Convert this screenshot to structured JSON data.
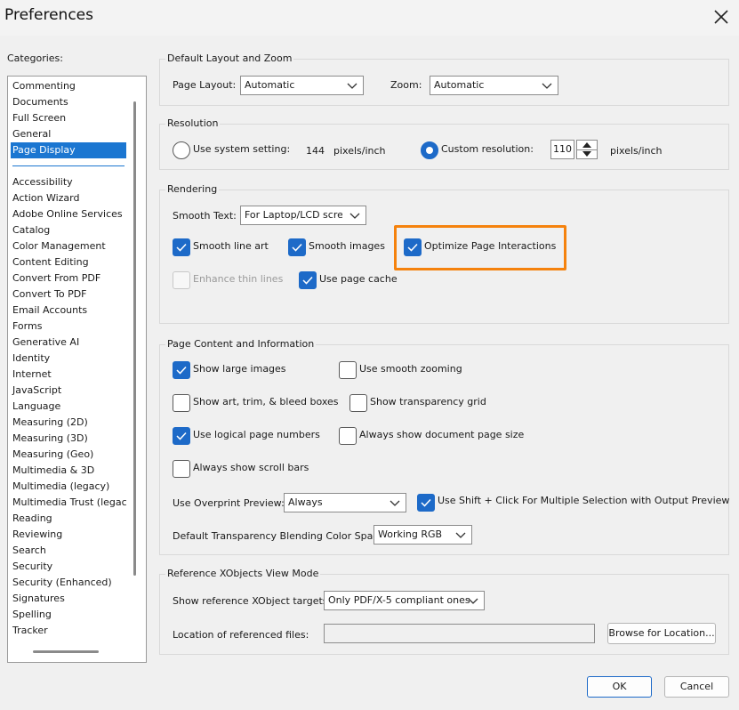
{
  "window": {
    "title": "Preferences"
  },
  "categories": {
    "label": "Categories:",
    "top_items": [
      "Commenting",
      "Documents",
      "Full Screen",
      "General",
      "Page Display"
    ],
    "selected": "Page Display",
    "items": [
      "Accessibility",
      "Action Wizard",
      "Adobe Online Services",
      "Catalog",
      "Color Management",
      "Content Editing",
      "Convert From PDF",
      "Convert To PDF",
      "Email Accounts",
      "Forms",
      "Generative AI",
      "Identity",
      "Internet",
      "JavaScript",
      "Language",
      "Measuring (2D)",
      "Measuring (3D)",
      "Measuring (Geo)",
      "Multimedia & 3D",
      "Multimedia (legacy)",
      "Multimedia Trust (legacy)",
      "Reading",
      "Reviewing",
      "Search",
      "Security",
      "Security (Enhanced)",
      "Signatures",
      "Spelling",
      "Tracker"
    ]
  },
  "layout_zoom": {
    "title": "Default Layout and Zoom",
    "page_layout_label": "Page Layout:",
    "page_layout_value": "Automatic",
    "zoom_label": "Zoom:",
    "zoom_value": "Automatic"
  },
  "resolution": {
    "title": "Resolution",
    "system_label": "Use system setting:",
    "system_value": "144",
    "system_unit": "pixels/inch",
    "custom_label": "Custom resolution:",
    "custom_value": "110",
    "custom_unit": "pixels/inch",
    "selected": "custom"
  },
  "rendering": {
    "title": "Rendering",
    "smooth_text_label": "Smooth Text:",
    "smooth_text_value": "For Laptop/LCD screens",
    "smooth_line_art": {
      "label": "Smooth line art",
      "checked": true
    },
    "smooth_images": {
      "label": "Smooth images",
      "checked": true
    },
    "optimize_page": {
      "label": "Optimize Page Interactions",
      "checked": true
    },
    "enhance_thin": {
      "label": "Enhance thin lines",
      "checked": false,
      "disabled": true
    },
    "page_cache": {
      "label": "Use page cache",
      "checked": true
    }
  },
  "page_content": {
    "title": "Page Content and Information",
    "show_large_images": {
      "label": "Show large images",
      "checked": true
    },
    "smooth_zooming": {
      "label": "Use smooth zooming",
      "checked": false
    },
    "art_trim_bleed": {
      "label": "Show art, trim, & bleed boxes",
      "checked": false
    },
    "transparency_grid": {
      "label": "Show transparency grid",
      "checked": false
    },
    "logical_page_numbers": {
      "label": "Use logical page numbers",
      "checked": true
    },
    "document_page_size": {
      "label": "Always show document page size",
      "checked": false
    },
    "scroll_bars": {
      "label": "Always show scroll bars",
      "checked": false
    },
    "overprint_label": "Use Overprint Preview:",
    "overprint_value": "Always",
    "shift_click": {
      "label": "Use Shift + Click For Multiple Selection with Output Preview",
      "checked": true
    },
    "blending_label": "Default Transparency Blending Color Space:",
    "blending_value": "Working RGB"
  },
  "xobjects": {
    "title": "Reference XObjects View Mode",
    "targets_label": "Show reference XObject targets:",
    "targets_value": "Only PDF/X-5 compliant ones",
    "location_label": "Location of referenced files:",
    "location_value": "",
    "browse_label": "Browse for Location..."
  },
  "buttons": {
    "ok": "OK",
    "cancel": "Cancel"
  },
  "colors": {
    "accent": "#1d6ac8",
    "selection": "#1b76d1",
    "highlight": "#f5820d"
  }
}
